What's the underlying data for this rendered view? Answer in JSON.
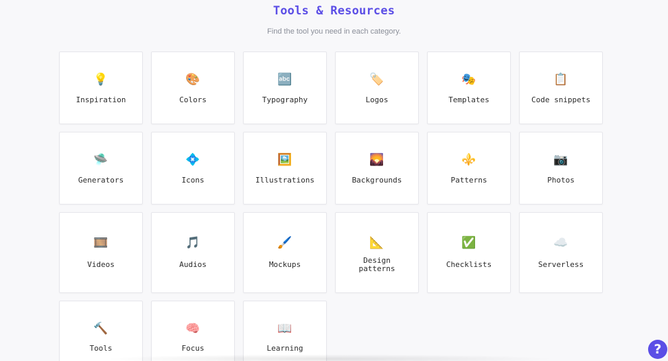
{
  "header": {
    "title": "Tools & Resources",
    "subtitle": "Find the tool you need in each category."
  },
  "categories": [
    {
      "label": "Inspiration",
      "icon": "💡",
      "icon_name": "light-bulb-icon"
    },
    {
      "label": "Colors",
      "icon": "🎨",
      "icon_name": "palette-icon"
    },
    {
      "label": "Typography",
      "icon": "🔤",
      "icon_name": "abc-icon"
    },
    {
      "label": "Logos",
      "icon": "🏷️",
      "icon_name": "label-tag-icon"
    },
    {
      "label": "Templates",
      "icon": "🎭",
      "icon_name": "theater-masks-icon"
    },
    {
      "label": "Code snippets",
      "icon": "📋",
      "icon_name": "clipboard-icon"
    },
    {
      "label": "Generators",
      "icon": "🛸",
      "icon_name": "flying-saucer-icon"
    },
    {
      "label": "Icons",
      "icon": "💠",
      "icon_name": "diamond-icon"
    },
    {
      "label": "Illustrations",
      "icon": "🖼️",
      "icon_name": "framed-picture-icon"
    },
    {
      "label": "Backgrounds",
      "icon": "🌄",
      "icon_name": "sunrise-icon"
    },
    {
      "label": "Patterns",
      "icon": "⚜️",
      "icon_name": "fleur-de-lis-icon"
    },
    {
      "label": "Photos",
      "icon": "📷",
      "icon_name": "camera-icon"
    },
    {
      "label": "Videos",
      "icon": "🎞️",
      "icon_name": "film-frames-icon"
    },
    {
      "label": "Audios",
      "icon": "🎵",
      "icon_name": "music-note-icon"
    },
    {
      "label": "Mockups",
      "icon": "🖌️",
      "icon_name": "paintbrush-icon"
    },
    {
      "label": "Design patterns",
      "icon": "📐",
      "icon_name": "triangular-ruler-icon"
    },
    {
      "label": "Checklists",
      "icon": "✅",
      "icon_name": "check-mark-icon"
    },
    {
      "label": "Serverless",
      "icon": "☁️",
      "icon_name": "cloud-icon"
    },
    {
      "label": "Tools",
      "icon": "🔨",
      "icon_name": "hammer-icon"
    },
    {
      "label": "Focus",
      "icon": "🧠",
      "icon_name": "brain-icon"
    },
    {
      "label": "Learning",
      "icon": "📖",
      "icon_name": "open-book-icon"
    }
  ],
  "help": {
    "label": "?"
  },
  "colors": {
    "accent": "#5b4ee6",
    "background": "#f8f8fa",
    "card": "#ffffff"
  }
}
